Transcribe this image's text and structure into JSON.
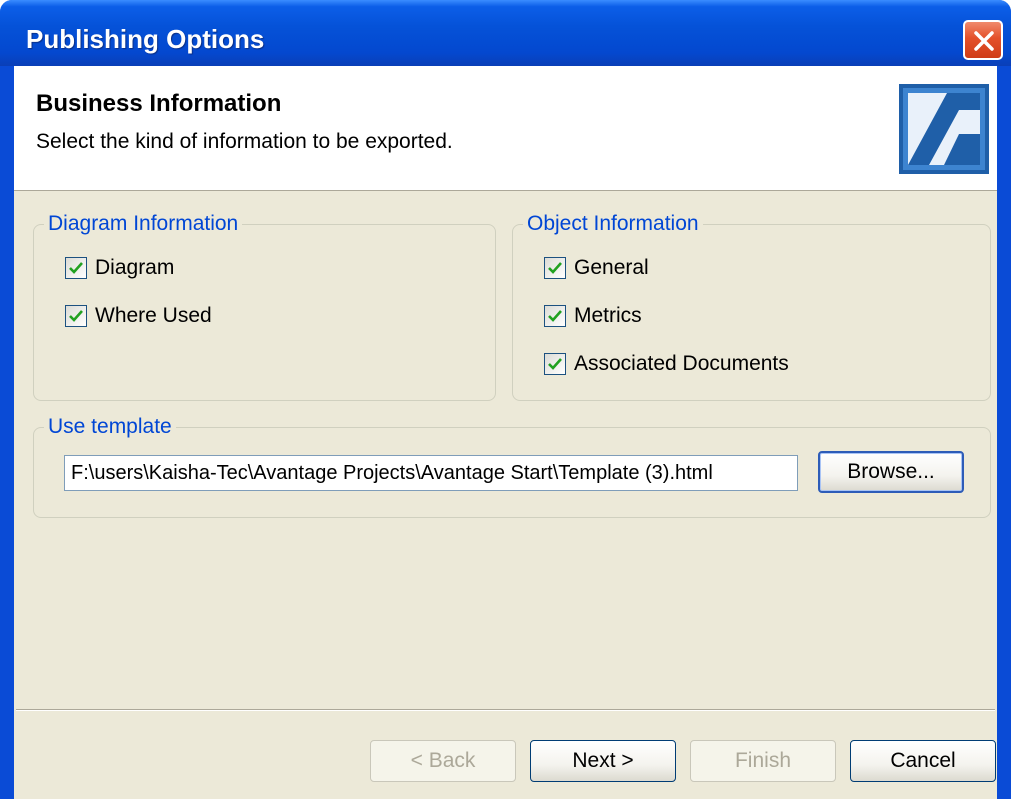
{
  "window": {
    "title": "Publishing Options"
  },
  "header": {
    "title": "Business Information",
    "subtitle": "Select the kind of information to be exported."
  },
  "diagram_group": {
    "title": "Diagram Information",
    "items": [
      {
        "label": "Diagram",
        "checked": true
      },
      {
        "label": "Where Used",
        "checked": true
      }
    ]
  },
  "object_group": {
    "title": "Object Information",
    "items": [
      {
        "label": "General",
        "checked": true
      },
      {
        "label": "Metrics",
        "checked": true
      },
      {
        "label": "Associated Documents",
        "checked": true
      }
    ]
  },
  "template_group": {
    "title": "Use template",
    "path_value": "F:\\users\\Kaisha-Tec\\Avantage Projects\\Avantage Start\\Template (3).html",
    "browse_label": "Browse..."
  },
  "footer": {
    "back_label": "< Back",
    "next_label": "Next >",
    "finish_label": "Finish",
    "cancel_label": "Cancel"
  },
  "colors": {
    "title_bar": "#0552d8",
    "dialog_bg": "#ece9d8",
    "group_title": "#0046d5",
    "check_mark": "#21a121"
  }
}
